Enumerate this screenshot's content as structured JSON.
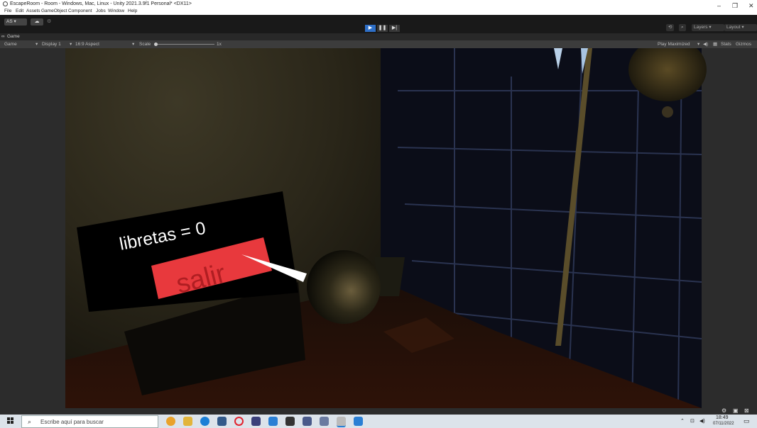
{
  "window": {
    "title": "EscapeRoom - Room - Windows, Mac, Linux - Unity 2021.3.9f1 Personal* <DX11>",
    "minimize": "–",
    "restore": "❐",
    "close": "✕"
  },
  "menu": [
    "File",
    "Edit",
    "Assets",
    "GameObject",
    "Component",
    "Jobs",
    "Window",
    "Help"
  ],
  "toolbar": {
    "account": "AS ▾",
    "cloud": "☁",
    "settings": "⚙",
    "play": "▶",
    "pause": "❚❚",
    "step": "▶|",
    "history": "⟲",
    "search": "⌕",
    "layers": "Layers",
    "layout": "Layout"
  },
  "game_tab": {
    "label": "Game"
  },
  "game_bar": {
    "mode": "Game",
    "display": "Display 1",
    "aspect": "16:9 Aspect",
    "scale_label": "Scale",
    "scale_value": "1x",
    "play_maximized": "Play Maximized",
    "mute": "◀)",
    "stats": "Stats",
    "gizmos": "Gizmos"
  },
  "scene": {
    "counter_text": "libretas = 0",
    "button_text": "salir"
  },
  "taskbar": {
    "search_placeholder": "Escribe aquí para buscar",
    "time": "18:49",
    "date": "07/11/2022"
  },
  "colors": {
    "accent_play": "#2e6fc7",
    "scene_button": "#e8393d"
  }
}
